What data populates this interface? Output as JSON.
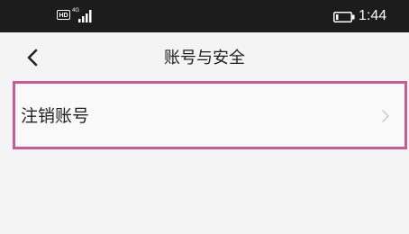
{
  "status_bar": {
    "hd_label": "HD",
    "network_label": "4G",
    "time": "1:44",
    "icons": [
      "hd-icon",
      "signal-icon",
      "battery-icon"
    ]
  },
  "header": {
    "title": "账号与安全",
    "back_icon": "chevron-left-icon"
  },
  "list": {
    "items": [
      {
        "label": "注销账号",
        "icon": "chevron-right-icon"
      }
    ]
  },
  "colors": {
    "status_bar_bg": "#1c1c1c",
    "page_bg": "#f4f4f4",
    "highlight_border": "#c95a96"
  }
}
